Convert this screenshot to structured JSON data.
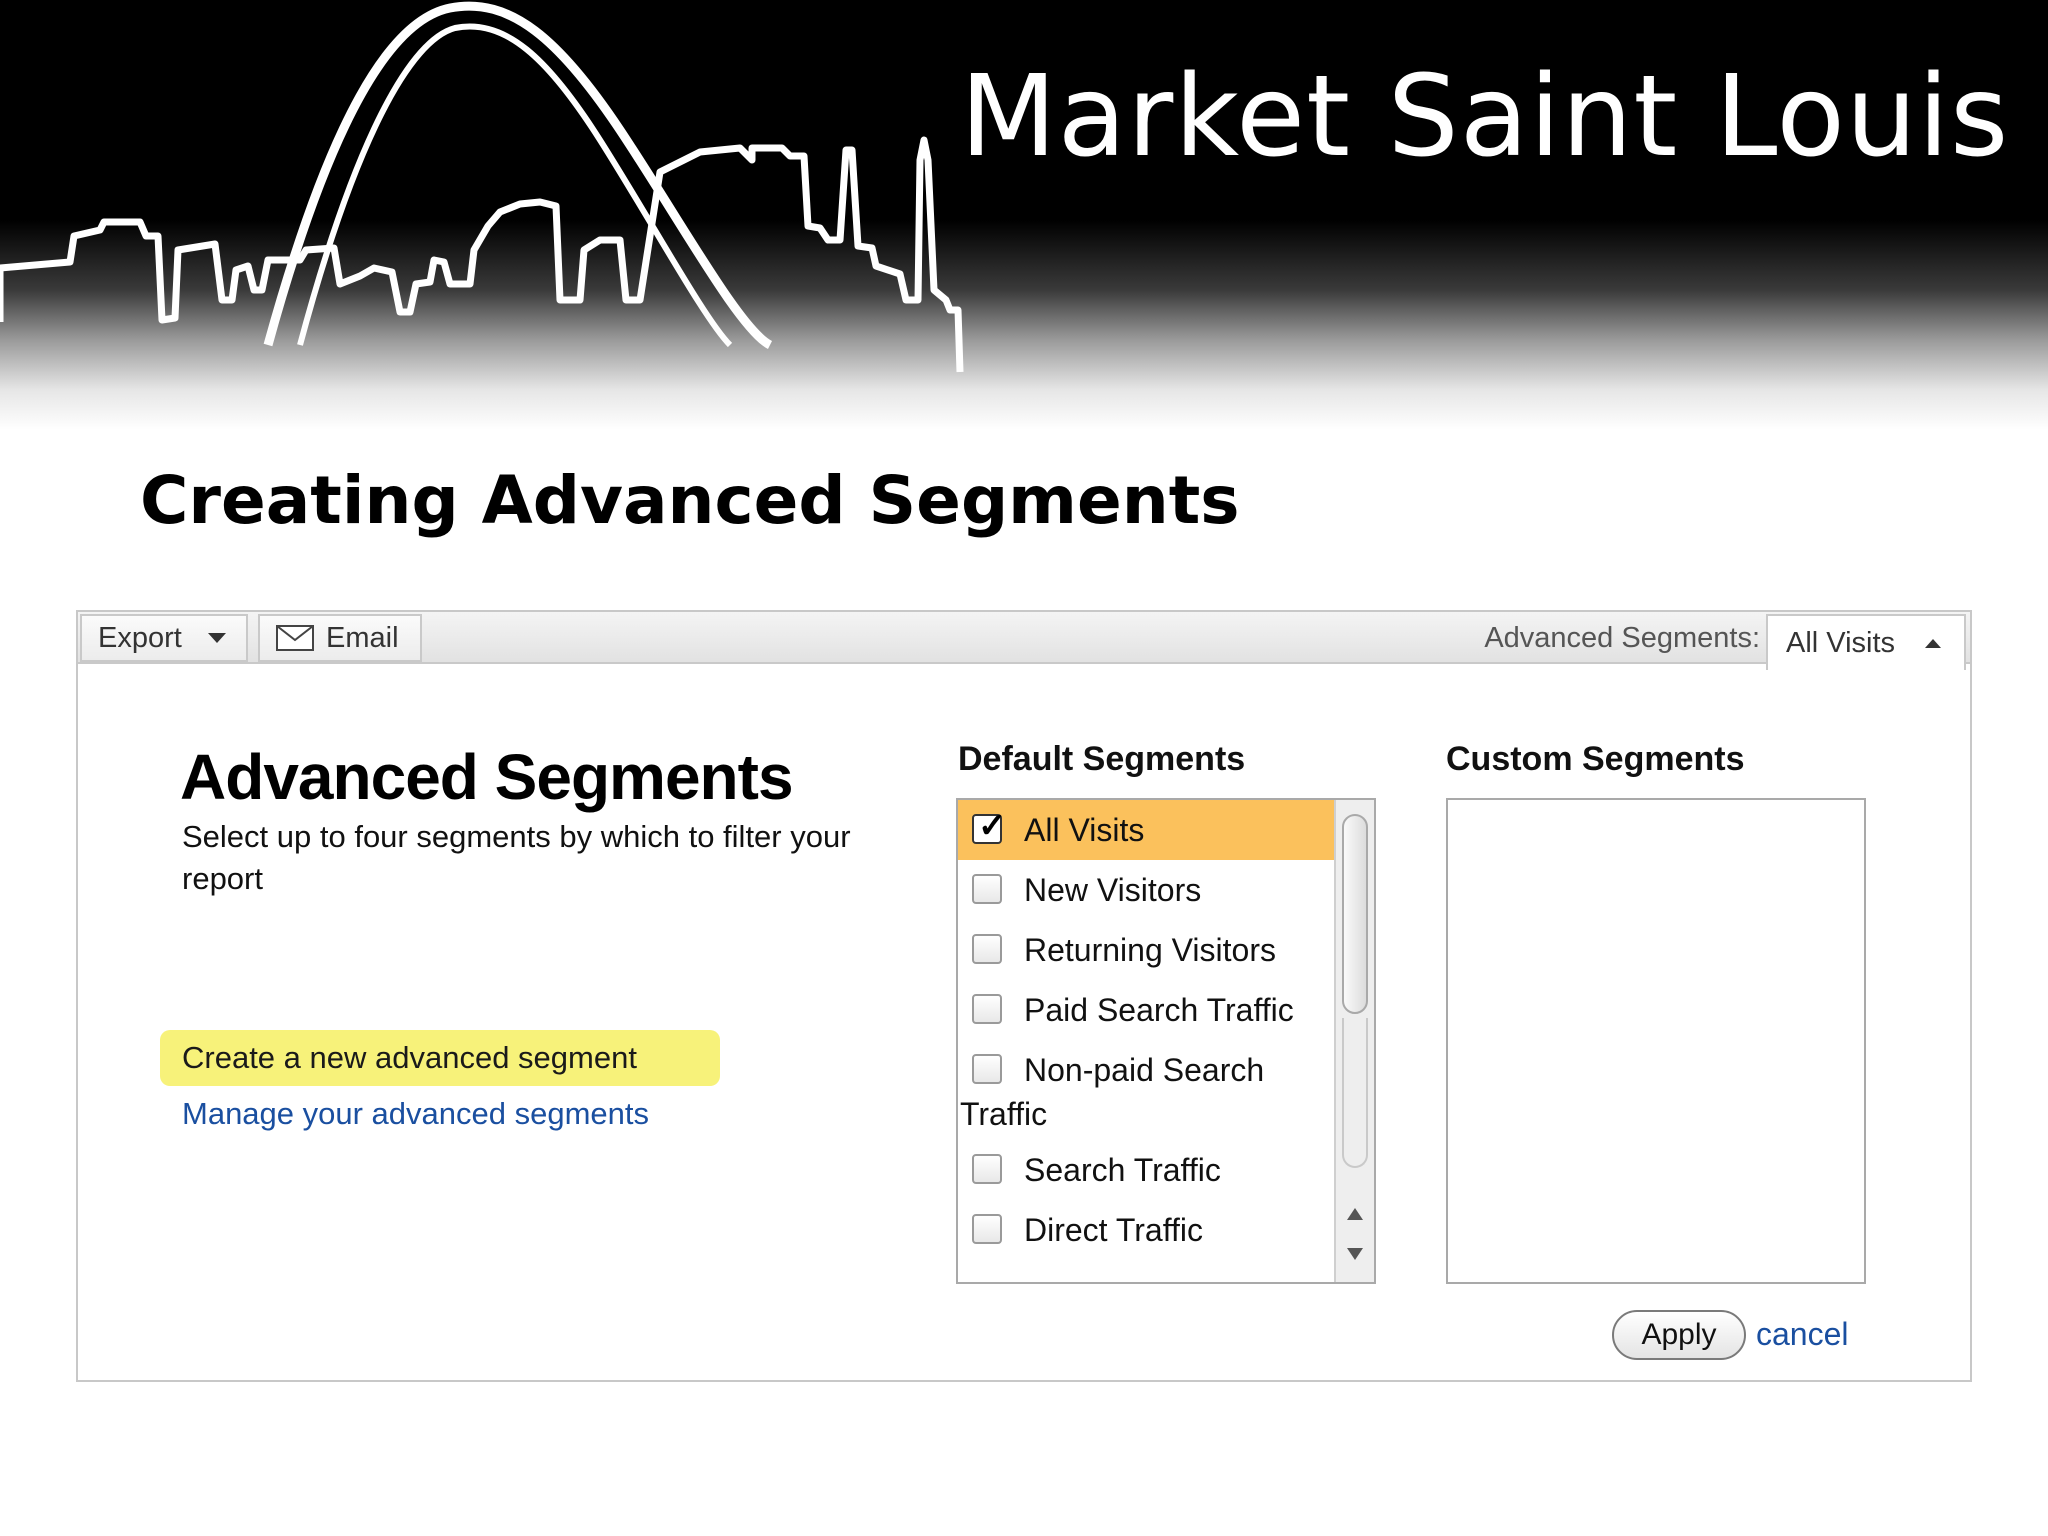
{
  "banner": {
    "brand": "Market Saint Louis"
  },
  "slide": {
    "title": "Creating Advanced Segments"
  },
  "toolbar": {
    "export_label": "Export",
    "email_label": "Email",
    "advanced_segments_label": "Advanced Segments:",
    "selected_segment": "All Visits"
  },
  "advanced": {
    "heading": "Advanced Segments",
    "description": "Select up to four segments by which to filter your report",
    "create_link": "Create a new advanced segment",
    "manage_link": "Manage your advanced segments"
  },
  "default_segments": {
    "title": "Default Segments",
    "items": [
      {
        "label": "All Visits",
        "checked": true
      },
      {
        "label": "New Visitors",
        "checked": false
      },
      {
        "label": "Returning Visitors",
        "checked": false
      },
      {
        "label": "Paid Search Traffic",
        "checked": false
      },
      {
        "label": "Non-paid Search",
        "label_cont": "Traffic",
        "checked": false
      },
      {
        "label": "Search Traffic",
        "checked": false
      },
      {
        "label": "Direct Traffic",
        "checked": false
      }
    ]
  },
  "custom_segments": {
    "title": "Custom Segments"
  },
  "actions": {
    "apply_label": "Apply",
    "cancel_label": "cancel"
  },
  "colors": {
    "selected_row": "#fbc15c",
    "highlight": "#f7f27a",
    "link": "#1a4fa0"
  }
}
